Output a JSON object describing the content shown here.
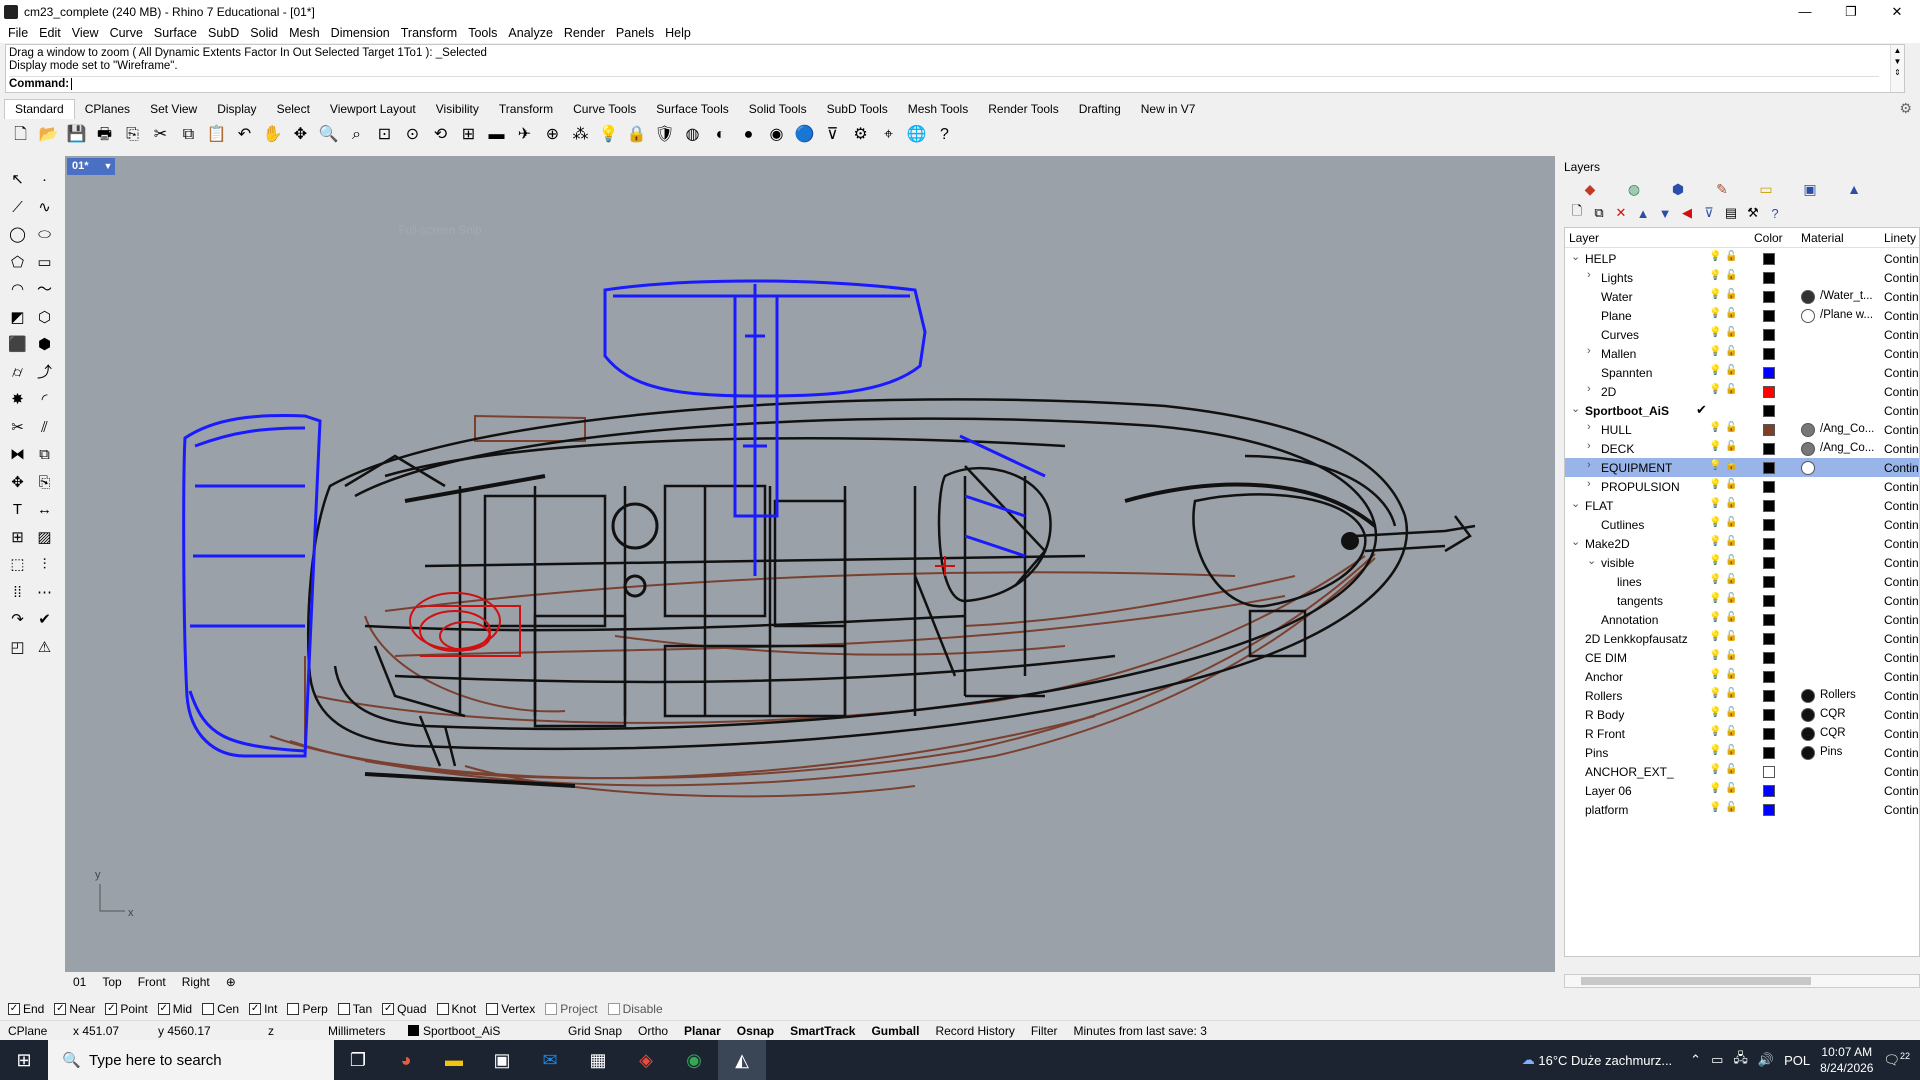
{
  "window": {
    "title": "cm23_complete (240 MB) - Rhino 7 Educational - [01*]",
    "controls": [
      "—",
      "❐",
      "✕"
    ]
  },
  "menu": [
    "File",
    "Edit",
    "View",
    "Curve",
    "Surface",
    "SubD",
    "Solid",
    "Mesh",
    "Dimension",
    "Transform",
    "Tools",
    "Analyze",
    "Render",
    "Panels",
    "Help"
  ],
  "command": {
    "history": [
      "Drag a window to zoom ( All  Dynamic  Extents  Factor  In  Out  Selected  Target  1To1 ): _Selected",
      "Display mode set to \"Wireframe\"."
    ],
    "prompt": "Command:"
  },
  "toolbar_tabs": [
    "Standard",
    "CPlanes",
    "Set View",
    "Display",
    "Select",
    "Viewport Layout",
    "Visibility",
    "Transform",
    "Curve Tools",
    "Surface Tools",
    "Solid Tools",
    "SubD Tools",
    "Mesh Tools",
    "Render Tools",
    "Drafting",
    "New in V7"
  ],
  "toolbar_icons": [
    {
      "name": "new-file-icon",
      "glyph": "🗋"
    },
    {
      "name": "open-folder-icon",
      "glyph": "📂"
    },
    {
      "name": "save-icon",
      "glyph": "💾"
    },
    {
      "name": "print-icon",
      "glyph": "🖶"
    },
    {
      "name": "export-icon",
      "glyph": "⎘"
    },
    {
      "name": "cut-icon",
      "glyph": "✂"
    },
    {
      "name": "copy-icon",
      "glyph": "⧉"
    },
    {
      "name": "paste-icon",
      "glyph": "📋"
    },
    {
      "name": "undo-icon",
      "glyph": "↶"
    },
    {
      "name": "pan-hand-icon",
      "glyph": "✋"
    },
    {
      "name": "move-view-icon",
      "glyph": "✥"
    },
    {
      "name": "zoom-icon",
      "glyph": "🔍"
    },
    {
      "name": "zoom-window-icon",
      "glyph": "⌕"
    },
    {
      "name": "zoom-extents-icon",
      "glyph": "⊡"
    },
    {
      "name": "zoom-selected-icon",
      "glyph": "⊙"
    },
    {
      "name": "rotate-view-icon",
      "glyph": "⟲"
    },
    {
      "name": "viewport-grid-icon",
      "glyph": "⊞"
    },
    {
      "name": "car-icon",
      "glyph": "▬"
    },
    {
      "name": "plane-icon",
      "glyph": "✈"
    },
    {
      "name": "cplane-icon",
      "glyph": "⊕"
    },
    {
      "name": "osnap-icon",
      "glyph": "⁂"
    },
    {
      "name": "light-bulb-icon",
      "glyph": "💡"
    },
    {
      "name": "lock-icon",
      "glyph": "🔒"
    },
    {
      "name": "layer-icon",
      "glyph": "🛡"
    },
    {
      "name": "color-wheel-icon",
      "glyph": "◍"
    },
    {
      "name": "shaded-sphere-icon",
      "glyph": "◐"
    },
    {
      "name": "rendered-sphere-icon",
      "glyph": "●"
    },
    {
      "name": "material-sphere-icon",
      "glyph": "◉"
    },
    {
      "name": "blue-sphere-icon",
      "glyph": "🔵"
    },
    {
      "name": "filter-select-icon",
      "glyph": "⊽"
    },
    {
      "name": "options-gear-icon",
      "glyph": "⚙"
    },
    {
      "name": "dimension-icon",
      "glyph": "⌖"
    },
    {
      "name": "globe-icon",
      "glyph": "🌐"
    },
    {
      "name": "help-icon",
      "glyph": "?"
    }
  ],
  "left_tools": [
    "select-arrow-icon",
    "point-icon",
    "polyline-icon",
    "curve-icon",
    "circle-icon",
    "ellipse-icon",
    "polygon-icon",
    "rectangle-icon",
    "arc-icon",
    "freeform-curve-icon",
    "surface-icon",
    "loft-icon",
    "box-icon",
    "solid-union-icon",
    "cylinder-icon",
    "extrude-icon",
    "explode-icon",
    "fillet-icon",
    "trim-icon",
    "split-icon",
    "join-icon",
    "group-icon",
    "move-icon",
    "copy-move-icon",
    "text-icon",
    "dimension-tool-icon",
    "array-icon",
    "hatch-icon",
    "mesh-box-icon",
    "mesh-line-icon",
    "grid-array-icon",
    "dots-icon",
    "sweep-icon",
    "check-icon",
    "layer-state-icon",
    "analyze-icon"
  ],
  "viewport": {
    "tab_label": "01*",
    "snip_hint": "Full-screen Snip",
    "axis_x": "x",
    "axis_y": "y"
  },
  "viewport_tabs": [
    "01",
    "Top",
    "Front",
    "Right",
    "⊕"
  ],
  "osnaps": [
    {
      "label": "End",
      "checked": true
    },
    {
      "label": "Near",
      "checked": true
    },
    {
      "label": "Point",
      "checked": true
    },
    {
      "label": "Mid",
      "checked": true
    },
    {
      "label": "Cen",
      "checked": false
    },
    {
      "label": "Int",
      "checked": true
    },
    {
      "label": "Perp",
      "checked": false
    },
    {
      "label": "Tan",
      "checked": false
    },
    {
      "label": "Quad",
      "checked": true
    },
    {
      "label": "Knot",
      "checked": false
    },
    {
      "label": "Vertex",
      "checked": false
    },
    {
      "label": "Project",
      "checked": false,
      "disabled": true
    },
    {
      "label": "Disable",
      "checked": false,
      "disabled": true
    }
  ],
  "status": {
    "cplane": "CPlane",
    "x": "x 451.07",
    "y": "y 4560.17",
    "z": "z",
    "units": "Millimeters",
    "layer": "Sportboot_AiS",
    "grid_snap": "Grid Snap",
    "ortho": "Ortho",
    "planar": "Planar",
    "osnap": "Osnap",
    "smarttrack": "SmartTrack",
    "gumball": "Gumball",
    "record_history": "Record History",
    "filter": "Filter",
    "save_info": "Minutes from last save: 3"
  },
  "taskbar": {
    "search_placeholder": "Type here to search",
    "weather": "16°C  Duże zachmurz...",
    "language": "POL",
    "time": "10:07 AM",
    "date": "8/24/2026",
    "notif_count": "22"
  },
  "layers_panel": {
    "title": "Layers",
    "columns": {
      "layer": "Layer",
      "color": "Color",
      "material": "Material",
      "linetype": "Linety"
    },
    "rows": [
      {
        "name": "HELP",
        "level": 0,
        "arrow": "⌄",
        "color": "#000000",
        "linetype": "Contin"
      },
      {
        "name": "Lights",
        "level": 1,
        "arrow": "›",
        "color": "#000000",
        "linetype": "Contin"
      },
      {
        "name": "Water",
        "level": 1,
        "arrow": "",
        "color": "#000000",
        "material": "/Water_t...",
        "mat_color": "#333333",
        "linetype": "Contin"
      },
      {
        "name": "Plane",
        "level": 1,
        "arrow": "",
        "color": "#000000",
        "material": "/Plane w...",
        "mat_color": "#ffffff",
        "linetype": "Contin"
      },
      {
        "name": "Curves",
        "level": 1,
        "arrow": "",
        "color": "#000000",
        "linetype": "Contin"
      },
      {
        "name": "Mallen",
        "level": 1,
        "arrow": "›",
        "color": "#000000",
        "linetype": "Contin"
      },
      {
        "name": "Spannten",
        "level": 1,
        "arrow": "",
        "color": "#0000ff",
        "linetype": "Contin"
      },
      {
        "name": "2D",
        "level": 1,
        "arrow": "›",
        "color": "#ff0000",
        "linetype": "Contin"
      },
      {
        "name": "Sportboot_AiS",
        "level": 0,
        "arrow": "⌄",
        "color": "#000000",
        "linetype": "Contin",
        "current": true
      },
      {
        "name": "HULL",
        "level": 1,
        "arrow": "›",
        "color": "#7b3f2a",
        "material": "/Ang_Co...",
        "mat_color": "#777777",
        "linetype": "Contin"
      },
      {
        "name": "DECK",
        "level": 1,
        "arrow": "›",
        "color": "#000000",
        "material": "/Ang_Co...",
        "mat_color": "#777777",
        "linetype": "Contin"
      },
      {
        "name": "EQUIPMENT",
        "level": 1,
        "arrow": "›",
        "color": "#000000",
        "mat_color": "#ffffff",
        "linetype": "Contin",
        "selected": true
      },
      {
        "name": "PROPULSION",
        "level": 1,
        "arrow": "›",
        "color": "#000000",
        "linetype": "Contin"
      },
      {
        "name": "FLAT",
        "level": 0,
        "arrow": "⌄",
        "color": "#000000",
        "linetype": "Contin"
      },
      {
        "name": "Cutlines",
        "level": 1,
        "arrow": "",
        "color": "#000000",
        "linetype": "Contin"
      },
      {
        "name": "Make2D",
        "level": 0,
        "arrow": "⌄",
        "color": "#000000",
        "linetype": "Contin"
      },
      {
        "name": "visible",
        "level": 1,
        "arrow": "⌄",
        "color": "#000000",
        "linetype": "Contin"
      },
      {
        "name": "lines",
        "level": 2,
        "arrow": "",
        "color": "#000000",
        "linetype": "Contin"
      },
      {
        "name": "tangents",
        "level": 2,
        "arrow": "",
        "color": "#000000",
        "linetype": "Contin"
      },
      {
        "name": "Annotation",
        "level": 1,
        "arrow": "",
        "color": "#000000",
        "linetype": "Contin"
      },
      {
        "name": "2D Lenkkopfausatz",
        "level": 0,
        "arrow": "",
        "color": "#000000",
        "linetype": "Contin"
      },
      {
        "name": "CE DIM",
        "level": 0,
        "arrow": "",
        "color": "#000000",
        "linetype": "Contin"
      },
      {
        "name": "Anchor",
        "level": 0,
        "arrow": "",
        "color": "#000000",
        "linetype": "Contin"
      },
      {
        "name": "Rollers",
        "level": 0,
        "arrow": "",
        "color": "#000000",
        "material": "Rollers",
        "mat_color": "#111111",
        "linetype": "Contin"
      },
      {
        "name": "R Body",
        "level": 0,
        "arrow": "",
        "color": "#000000",
        "material": "CQR",
        "mat_color": "#111111",
        "linetype": "Contin"
      },
      {
        "name": "R Front",
        "level": 0,
        "arrow": "",
        "color": "#000000",
        "material": "CQR",
        "mat_color": "#111111",
        "linetype": "Contin"
      },
      {
        "name": "Pins",
        "level": 0,
        "arrow": "",
        "color": "#000000",
        "material": "Pins",
        "mat_color": "#111111",
        "linetype": "Contin"
      },
      {
        "name": "ANCHOR_EXT_",
        "level": 0,
        "arrow": "",
        "color": "#ffffff",
        "linetype": "Contin"
      },
      {
        "name": "Layer 06",
        "level": 0,
        "arrow": "",
        "color": "#0000ff",
        "linetype": "Contin"
      },
      {
        "name": "platform",
        "level": 0,
        "arrow": "",
        "color": "#0000ff",
        "linetype": "Contin"
      }
    ]
  },
  "colors": {
    "viewport_bg": "#9ba1a8",
    "selection": "#99b4e8",
    "wire_black": "#111111",
    "wire_brown": "#7a4030",
    "wire_blue": "#1a1aff",
    "wire_red": "#d01010"
  }
}
